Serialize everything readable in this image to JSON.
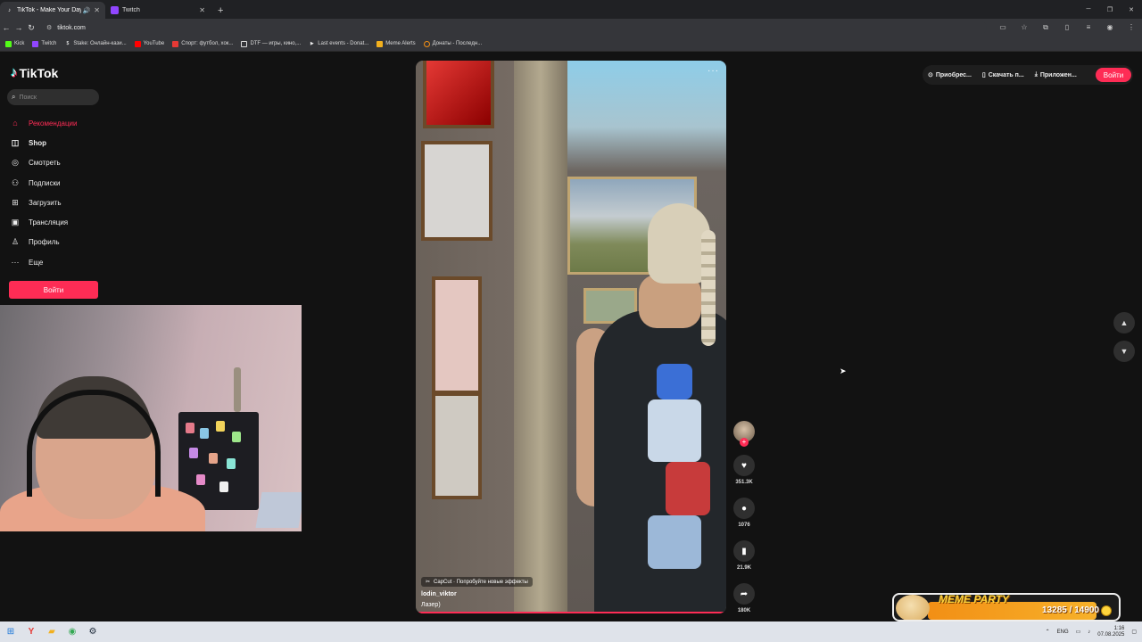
{
  "browser": {
    "tabs": [
      {
        "label": "TikTok - Make Your Day",
        "active": true,
        "icon": "tiktok-icon"
      },
      {
        "label": "Twitch",
        "active": false,
        "icon": "twitch-icon"
      }
    ],
    "url": "tiktok.com",
    "bookmarks": [
      {
        "label": "Kick",
        "color": "#53fc18"
      },
      {
        "label": "Twitch",
        "color": "#9146ff"
      },
      {
        "label": "Stake: Онлайн-кази...",
        "color": "#ffffff"
      },
      {
        "label": "YouTube",
        "color": "#ff0000"
      },
      {
        "label": "Спорт: футбол, хок...",
        "color": "#e53935"
      },
      {
        "label": "DTF — игры, кино,...",
        "color": "#dddddd"
      },
      {
        "label": "Last events - Donat...",
        "color": "#eeeeee"
      },
      {
        "label": "Meme Alerts",
        "color": "#f2b01e"
      },
      {
        "label": "Донаты - Последн...",
        "color": "#f28f15"
      }
    ]
  },
  "tiktok": {
    "logo": "TikTok",
    "search_placeholder": "Поиск",
    "nav": [
      {
        "label": "Рекомендации",
        "icon": "home-icon",
        "active": true
      },
      {
        "label": "Shop",
        "icon": "shop-icon",
        "bold": true
      },
      {
        "label": "Смотреть",
        "icon": "compass-icon"
      },
      {
        "label": "Подписки",
        "icon": "following-icon"
      },
      {
        "label": "Загрузить",
        "icon": "upload-icon"
      },
      {
        "label": "Трансляция",
        "icon": "live-icon"
      },
      {
        "label": "Профиль",
        "icon": "profile-icon"
      },
      {
        "label": "Еще",
        "icon": "more-icon"
      }
    ],
    "login_label": "Войти",
    "topbar": {
      "items": [
        {
          "label": "Приобрес...",
          "icon": "coin-icon"
        },
        {
          "label": "Скачать п...",
          "icon": "phone-icon"
        },
        {
          "label": "Приложен...",
          "icon": "download-icon"
        }
      ],
      "login_label": "Войти"
    },
    "video": {
      "effect": "CapCut · Попробуйте новые эффекты",
      "username": "lodin_viktor",
      "description": "Лазер)"
    },
    "actions": {
      "likes": "351.3K",
      "comments": "1076",
      "saves": "21.9K",
      "shares": "180K"
    }
  },
  "meme_party": {
    "title": "MEME PARTY",
    "progress_text": "13285 / 14900",
    "current": 13285,
    "goal": 14900
  },
  "taskbar": {
    "lang": "ENG",
    "time": "1:16",
    "date": "07.08.2025"
  }
}
